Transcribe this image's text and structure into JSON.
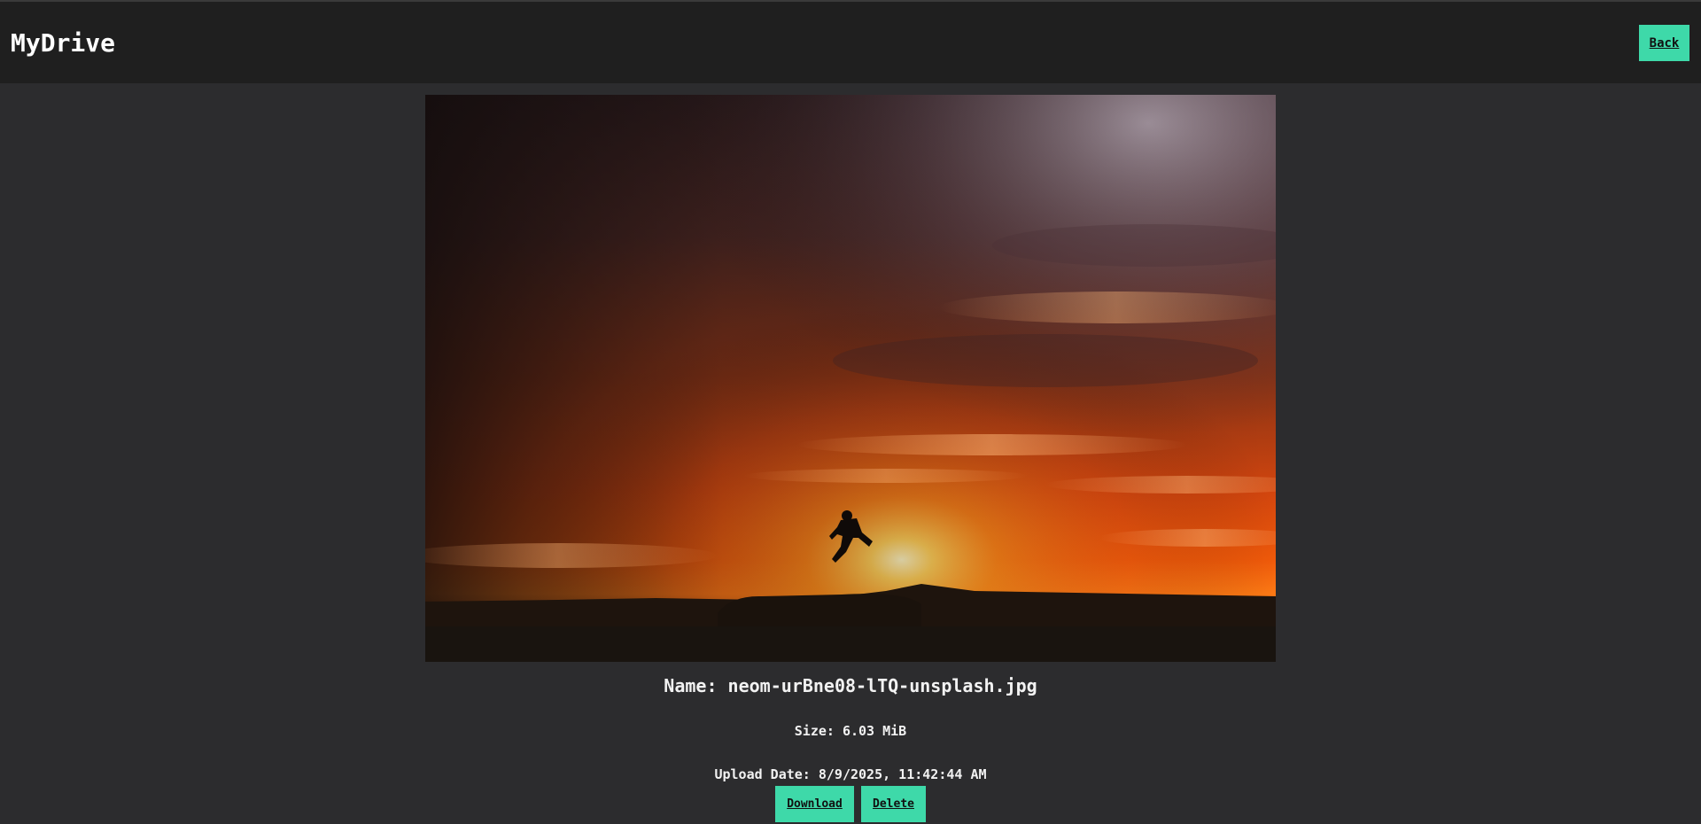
{
  "app": {
    "title": "MyDrive"
  },
  "header": {
    "back_label": "Back"
  },
  "file": {
    "name_text": "Name: neom-urBne08-lTQ-unsplash.jpg",
    "size_text": "Size: 6.03 MiB",
    "date_text": "Upload Date: 8/9/2025, 11:42:44 AM"
  },
  "actions": {
    "download_label": "Download",
    "delete_label": "Delete"
  },
  "colors": {
    "accent": "#3ed9a9",
    "header_bg": "#1f1f1f",
    "page_bg": "#2c2c2e"
  }
}
